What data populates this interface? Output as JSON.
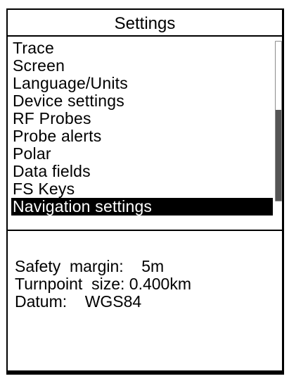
{
  "title": "Settings",
  "menu": {
    "items": [
      {
        "label": "Trace"
      },
      {
        "label": "Screen"
      },
      {
        "label": "Language/Units"
      },
      {
        "label": "Device  settings"
      },
      {
        "label": "RF  Probes"
      },
      {
        "label": "Probe  alerts"
      },
      {
        "label": "Polar"
      },
      {
        "label": "Data  fields"
      },
      {
        "label": "FS  Keys"
      },
      {
        "label": "Navigation  settings"
      }
    ],
    "selected_index": 9,
    "scroll_thumb_fraction": 0.57
  },
  "details": {
    "safety_margin": {
      "label": "Safety  margin:",
      "value": "5m"
    },
    "turnpoint_size": {
      "label": "Turnpoint  size:",
      "value": "0.400km"
    },
    "datum": {
      "label": "Datum:",
      "value": "WGS84"
    }
  },
  "colors": {
    "selection_background": "#000000",
    "selection_text": "#ffffff",
    "scroll_thumb": "#555555"
  }
}
